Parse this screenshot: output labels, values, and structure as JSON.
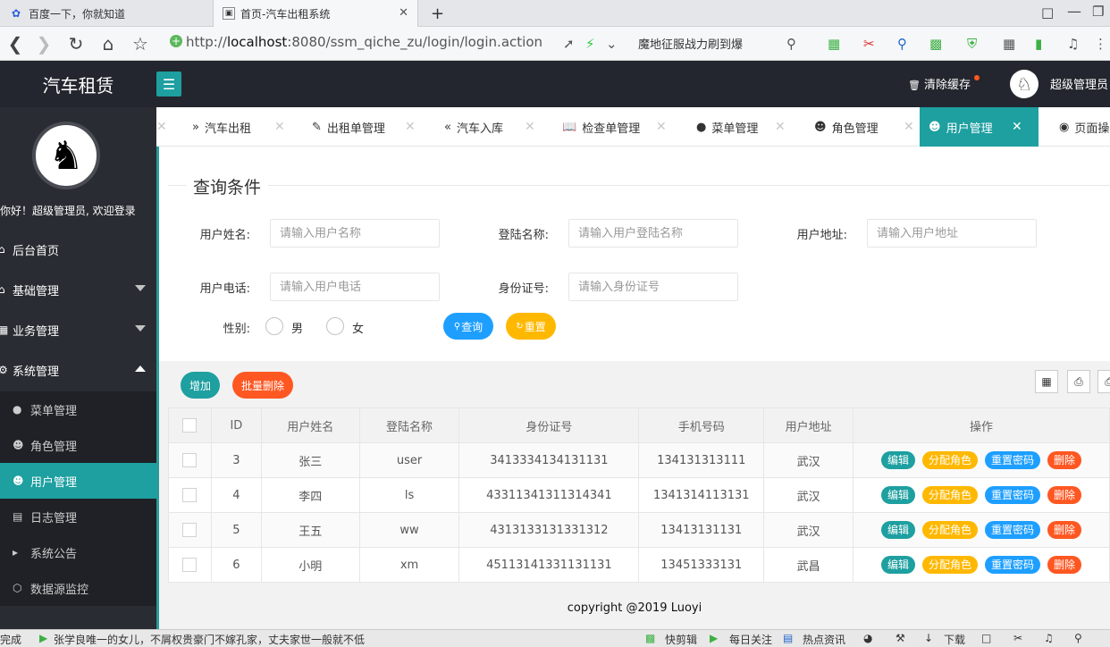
{
  "browser": {
    "tabs": [
      {
        "title": "百度一下，你就知道",
        "icon": "baidu-paw-icon"
      },
      {
        "title": "首页-汽车出租系统",
        "icon": "page-favicon"
      }
    ],
    "url_prefix": "http://",
    "url_host": "localhost",
    "url_rest": ":8080/ssm_qiche_zu/login/login.action",
    "search_text": "魔地征服战力刷到爆"
  },
  "app": {
    "title": "汽车租赁",
    "clear_cache": "清除缓存",
    "user_name": "超级管理员",
    "welcome": "你好！超级管理员, 欢迎登录"
  },
  "sidebar": {
    "items": [
      {
        "label": "后台首页",
        "icon": "home-icon"
      },
      {
        "label": "基础管理",
        "icon": "home-icon"
      },
      {
        "label": "业务管理",
        "icon": "grid-icon"
      },
      {
        "label": "系统管理",
        "icon": "gear-icon"
      }
    ],
    "sub_items": [
      {
        "label": "菜单管理",
        "icon": "circle-icon"
      },
      {
        "label": "角色管理",
        "icon": "user-icon"
      },
      {
        "label": "用户管理",
        "icon": "users-icon"
      },
      {
        "label": "日志管理",
        "icon": "log-icon"
      },
      {
        "label": "系统公告",
        "icon": "announce-icon"
      },
      {
        "label": "数据源监控",
        "icon": "cube-icon"
      }
    ]
  },
  "page_tabs": [
    {
      "label": "汽车出租",
      "icon": "double-chevron-right-icon"
    },
    {
      "label": "出租单管理",
      "icon": "edit-icon"
    },
    {
      "label": "汽车入库",
      "icon": "double-chevron-left-icon"
    },
    {
      "label": "检查单管理",
      "icon": "book-icon"
    },
    {
      "label": "菜单管理",
      "icon": "dot-icon"
    },
    {
      "label": "角色管理",
      "icon": "user-icon"
    },
    {
      "label": "用户管理",
      "icon": "users-icon"
    },
    {
      "label": "页面操",
      "icon": "target-icon"
    }
  ],
  "query": {
    "legend": "查询条件",
    "name_label": "用户姓名:",
    "name_placeholder": "请输入用户名称",
    "login_label": "登陆名称:",
    "login_placeholder": "请输入用户登陆名称",
    "address_label": "用户地址:",
    "address_placeholder": "请输入用户地址",
    "phone_label": "用户电话:",
    "phone_placeholder": "请输入用户电话",
    "idcard_label": "身份证号:",
    "idcard_placeholder": "请输入身份证号",
    "gender_label": "性别:",
    "male": "男",
    "female": "女",
    "search_btn": "查询",
    "reset_btn": "重置"
  },
  "toolbar": {
    "add": "增加",
    "batch_delete": "批量删除"
  },
  "table": {
    "headers": [
      "ID",
      "用户姓名",
      "登陆名称",
      "身份证号",
      "手机号码",
      "用户地址",
      "操作"
    ],
    "rows": [
      [
        "3",
        "张三",
        "user",
        "3413334134131131",
        "134131313111",
        "武汉"
      ],
      [
        "4",
        "李四",
        "ls",
        "43311341311314341",
        "1341314113131",
        "武汉"
      ],
      [
        "5",
        "王五",
        "ww",
        "4313133131331312",
        "13413131131",
        "武汉"
      ],
      [
        "6",
        "小明",
        "xm",
        "45113141331131131",
        "13451333131",
        "武昌"
      ]
    ],
    "actions": [
      "编辑",
      "分配角色",
      "重置密码",
      "删除"
    ]
  },
  "footer": "copyright @2019 Luoyi",
  "statusbar": {
    "left": "完成",
    "news": "张学良唯一的女儿，不屑权贵豪门不嫁孔家，丈夫家世一般就不低",
    "items": [
      "快剪辑",
      "每日关注",
      "热点资讯",
      "下载"
    ]
  },
  "colors": {
    "accent": "#1e9fa0",
    "warm": "#ffb800",
    "blue": "#1e9fff",
    "red": "#ff5722",
    "dark": "#23262e"
  }
}
